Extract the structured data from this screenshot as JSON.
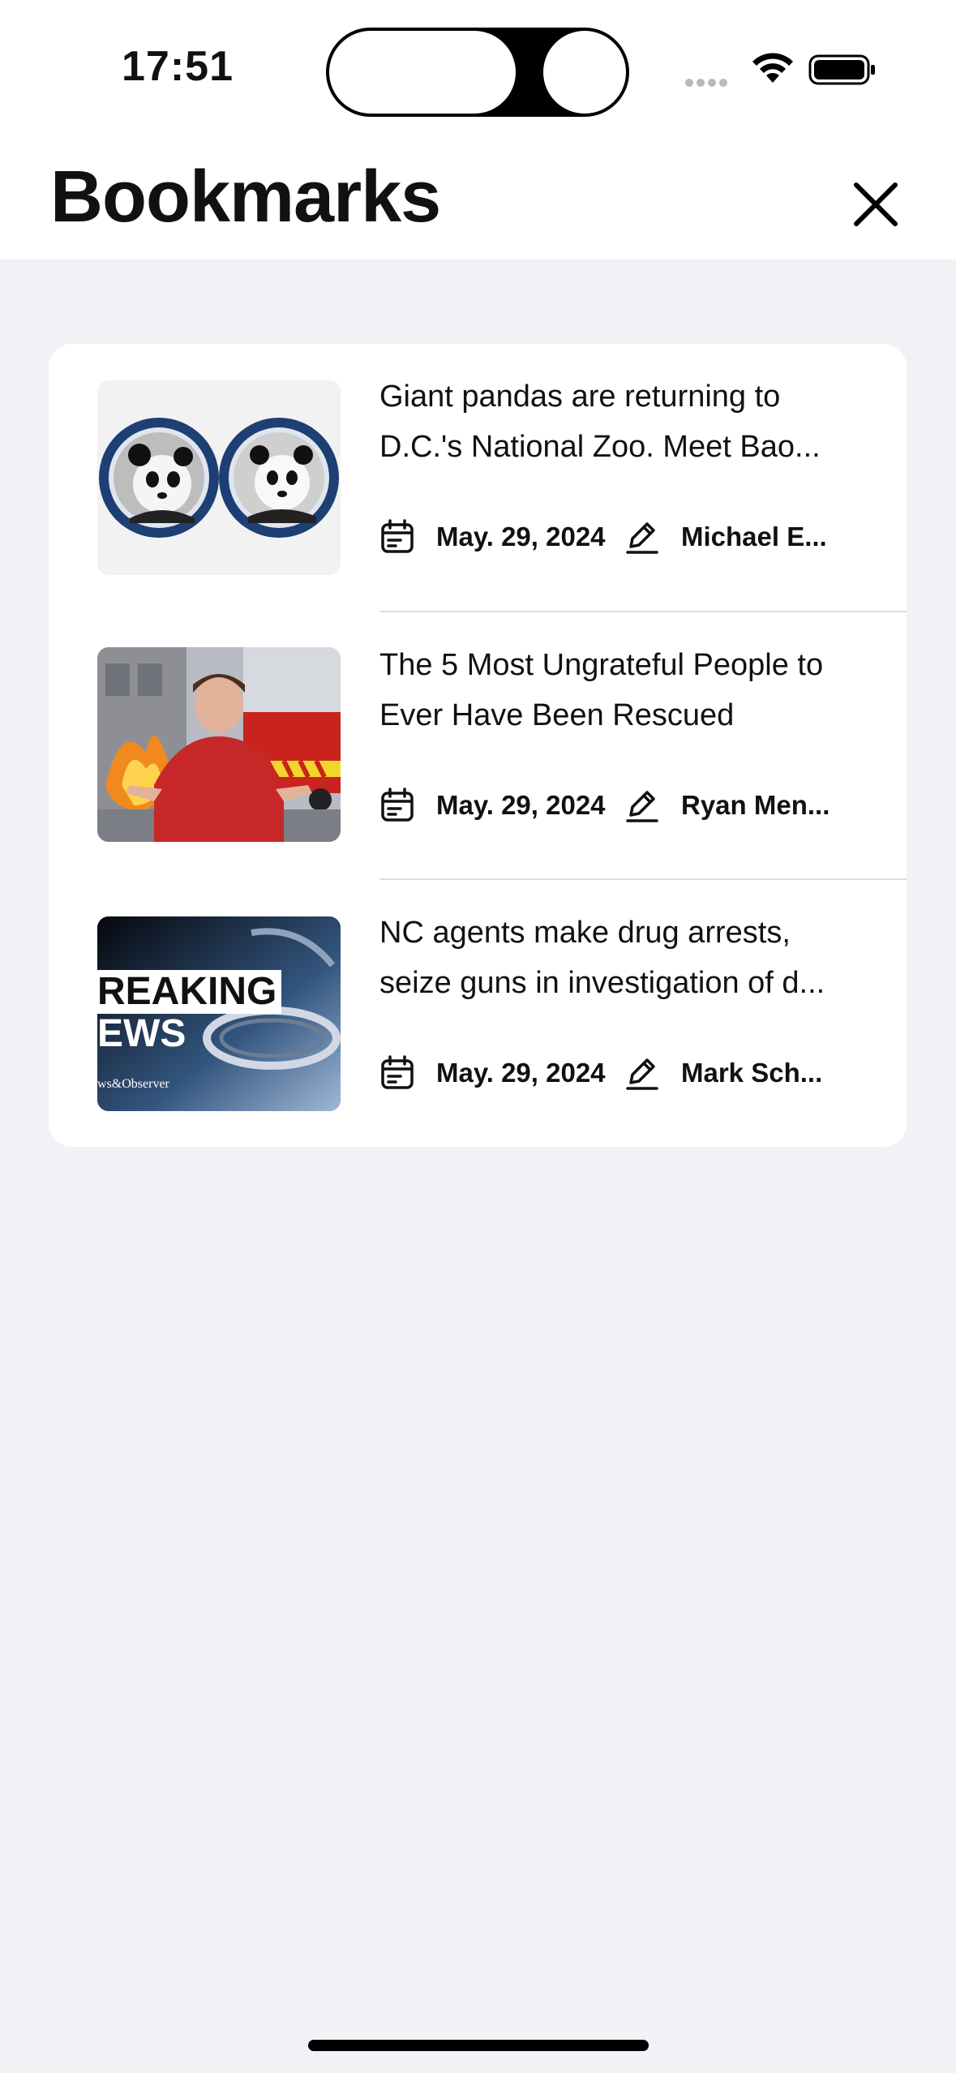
{
  "status_bar": {
    "time": "17:51"
  },
  "header": {
    "title": "Bookmarks",
    "close_icon": "close-icon"
  },
  "bookmarks": [
    {
      "title_line1": "Giant pandas are returning to",
      "title_line2": "D.C.'s National Zoo. Meet Bao...",
      "date": "May. 29, 2024",
      "author": "Michael E...",
      "thumb": "two-pandas-in-blue-porcelain-frames"
    },
    {
      "title_line1": "The 5 Most Ungrateful People to",
      "title_line2": "Ever Have Been Rescued",
      "date": "May. 29, 2024",
      "author": "Ryan Men...",
      "thumb": "boy-shrugging-fire-truck"
    },
    {
      "title_line1": "NC agents make drug arrests,",
      "title_line2": "seize guns in investigation of d...",
      "date": "May. 29, 2024",
      "author": "Mark Sch...",
      "thumb": "breaking-news-handcuffs",
      "thumb_text1": "REAKING",
      "thumb_text2": "EWS",
      "thumb_source": "ws&Observer"
    }
  ],
  "colors": {
    "background": "#f1f1f6",
    "card": "#ffffff",
    "text": "#111111",
    "divider": "#dddddd"
  }
}
